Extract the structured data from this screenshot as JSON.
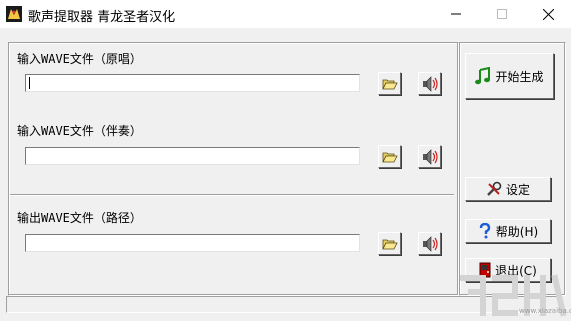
{
  "window": {
    "title": "歌声提取器 青龙圣者汉化",
    "controls": [
      "minimize",
      "maximize",
      "close"
    ]
  },
  "inputs": [
    {
      "label": "输入WAVE文件（原唱）",
      "value": "",
      "browse_icon": "folder-open-icon",
      "play_icon": "speaker-icon"
    },
    {
      "label": "输入WAVE文件（伴奏）",
      "value": "",
      "browse_icon": "folder-open-icon",
      "play_icon": "speaker-icon"
    }
  ],
  "output": {
    "label": "输出WAVE文件（路径）",
    "value": "",
    "browse_icon": "folder-open-icon",
    "play_icon": "speaker-icon"
  },
  "buttons": {
    "start": "开始生成",
    "settings": "设定",
    "help": "帮助(H)",
    "exit": "退出(C)"
  },
  "watermark": {
    "text": "www.xiazaiba.com"
  },
  "colors": {
    "background": "#f0f0f0",
    "titlebar": "#ffffff",
    "start_icon": "#1a8a1a",
    "help_icon": "#1e5bd6",
    "exit_icon": "#c00000"
  }
}
